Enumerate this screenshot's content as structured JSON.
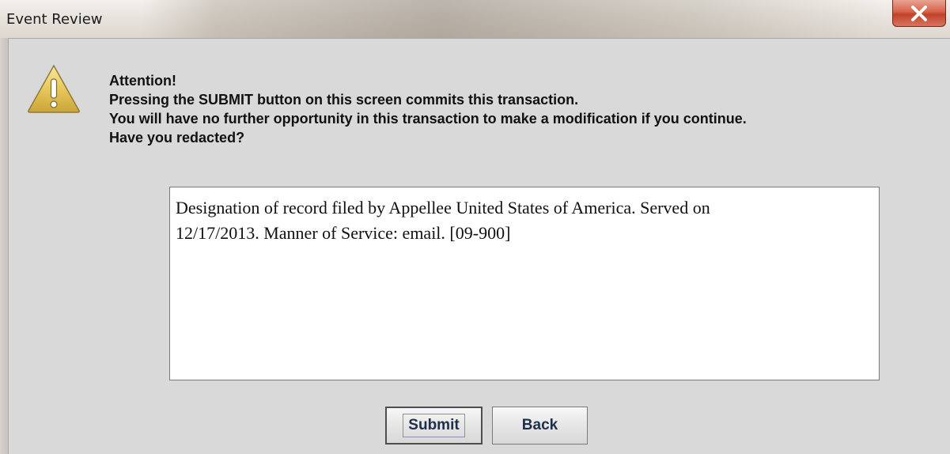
{
  "window": {
    "title": "Event Review",
    "close_glyph": "X"
  },
  "icons": {
    "close": "close-icon",
    "warning": "warning-icon"
  },
  "message": {
    "line1": "Attention!",
    "line2": "Pressing the SUBMIT button on this screen commits this transaction.",
    "line3": "You will have no further opportunity in this transaction to make a modification if you continue.",
    "line4": "Have you redacted?"
  },
  "docket_text": {
    "line1": "Designation of record filed by Appellee United States of America. Served on",
    "line2": "12/17/2013. Manner of Service: email. [09-900]"
  },
  "buttons": {
    "submit_label": "Submit",
    "back_label": "Back"
  },
  "colors": {
    "warning_fill": "#e8c85a",
    "close_button": "#c94a32"
  }
}
